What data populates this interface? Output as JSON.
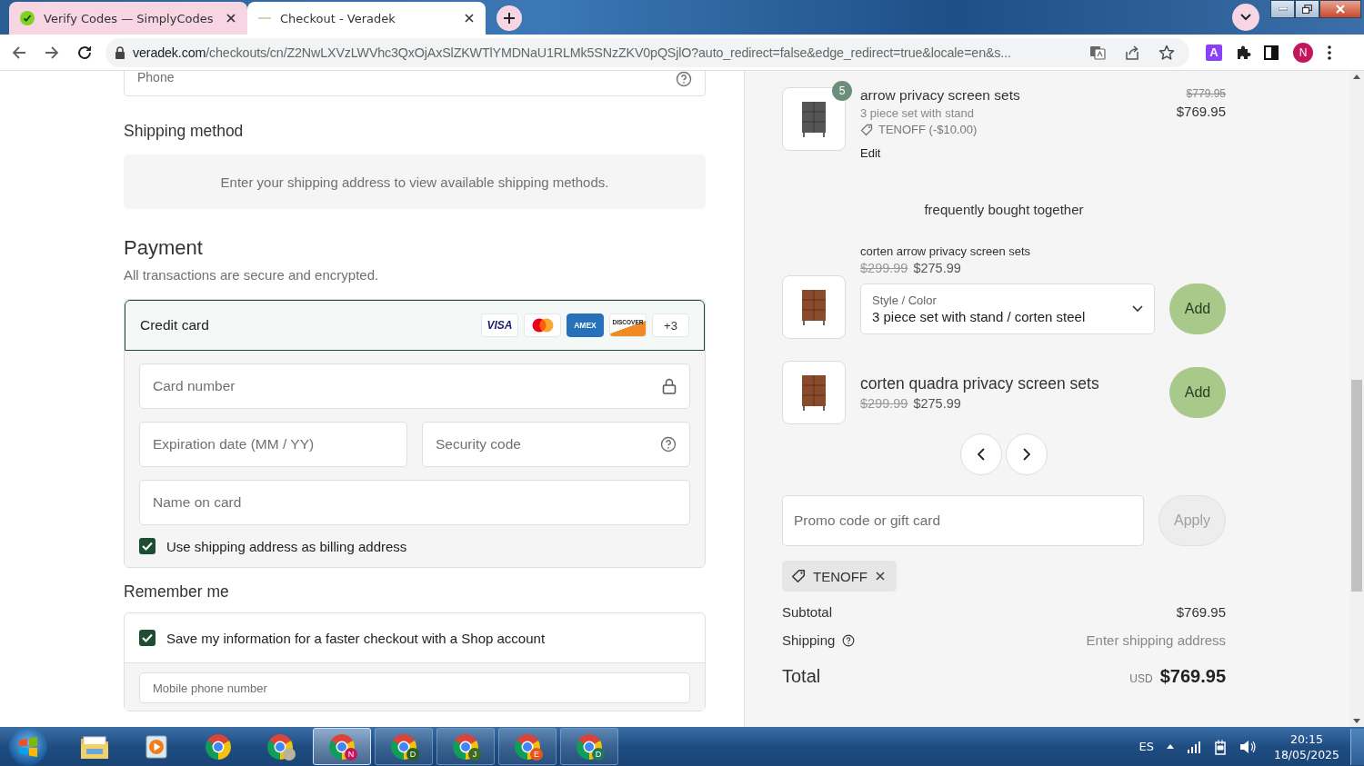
{
  "browser": {
    "tabs": [
      {
        "title": "Verify Codes — SimplyCodes",
        "selected": false
      },
      {
        "title": "Checkout - Veradek",
        "selected": true
      }
    ],
    "url": {
      "host": "veradek.com",
      "path": "/checkouts/cn/Z2NwLXVzLWVhc3QxOjAxSlZKWTlYMDNaU1RLMk5SNzZKV0pQSjlO?auto_redirect=false&edge_redirect=true&locale=en&s..."
    },
    "extension_letter": "A",
    "profile_initial": "N"
  },
  "checkout": {
    "phone": {
      "placeholder": "Phone"
    },
    "shipping_method": {
      "title": "Shipping method",
      "message": "Enter your shipping address to view available shipping methods."
    },
    "payment": {
      "title": "Payment",
      "subtitle": "All transactions are secure and encrypted.",
      "method": {
        "label": "Credit card",
        "selected": true
      },
      "card_brands": [
        {
          "kind": "visa",
          "text": "VISA"
        },
        {
          "kind": "mastercard"
        },
        {
          "kind": "amex",
          "text": "AMEX"
        },
        {
          "kind": "discover",
          "text": "DISCOVER"
        },
        {
          "kind": "more",
          "text": "+3"
        }
      ],
      "card_number": {
        "placeholder": "Card number"
      },
      "expiration": {
        "placeholder": "Expiration date (MM / YY)"
      },
      "security_code": {
        "placeholder": "Security code"
      },
      "name_on_card": {
        "placeholder": "Name on card"
      },
      "billing": {
        "label": "Use shipping address as billing address",
        "checked": true
      }
    },
    "remember_me": {
      "title": "Remember me",
      "save": {
        "label": "Save my information for a faster checkout with a Shop account",
        "checked": true
      },
      "mobile": {
        "placeholder": "Mobile phone number"
      }
    }
  },
  "summary": {
    "item": {
      "quantity": "5",
      "name": "arrow privacy screen sets",
      "variant": "3 piece set with stand",
      "discount": "TENOFF (-$10.00)",
      "edit": "Edit",
      "compare_price": "$779.95",
      "price": "$769.95"
    },
    "upsell": {
      "title": "frequently bought together",
      "products": [
        {
          "kind": "with_options",
          "name": "corten arrow privacy screen sets",
          "compare_price": "$299.99",
          "price": "$275.99",
          "option_label": "Style / Color",
          "option_value": "3 piece set with stand / corten steel",
          "add": "Add"
        },
        {
          "kind": "simple",
          "name": "corten quadra privacy screen sets",
          "compare_price": "$299.99",
          "price": "$275.99",
          "add": "Add"
        }
      ]
    },
    "promo": {
      "placeholder": "Promo code or gift card",
      "apply": "Apply",
      "apply_disabled": true
    },
    "applied_code": "TENOFF",
    "subtotal": {
      "label": "Subtotal",
      "value": "$769.95"
    },
    "shipping": {
      "label": "Shipping",
      "value": "Enter shipping address"
    },
    "total": {
      "label": "Total",
      "currency": "USD",
      "value": "$769.95"
    }
  },
  "taskbar": {
    "apps": [
      {
        "kind": "folder",
        "running": false,
        "selected": false
      },
      {
        "kind": "player",
        "running": false,
        "selected": false
      },
      {
        "kind": "browser",
        "running": false,
        "selected": false
      },
      {
        "kind": "browser_photo",
        "running": false,
        "selected": false
      },
      {
        "kind": "browser",
        "badge": "N",
        "color": "#c2185b",
        "running": true,
        "selected": true
      },
      {
        "kind": "browser",
        "badge": "D",
        "color": "#2e5e1e",
        "running": true,
        "selected": false
      },
      {
        "kind": "browser",
        "badge": "J",
        "color": "#3d6b1f",
        "running": true,
        "selected": false
      },
      {
        "kind": "browser",
        "badge": "E",
        "color": "#e8531f",
        "running": true,
        "selected": false
      },
      {
        "kind": "browser",
        "badge": "D",
        "color": "#1e7a5a",
        "running": true,
        "selected": false
      }
    ],
    "language": "ES",
    "time": "20:15",
    "date": "18/05/2025"
  }
}
